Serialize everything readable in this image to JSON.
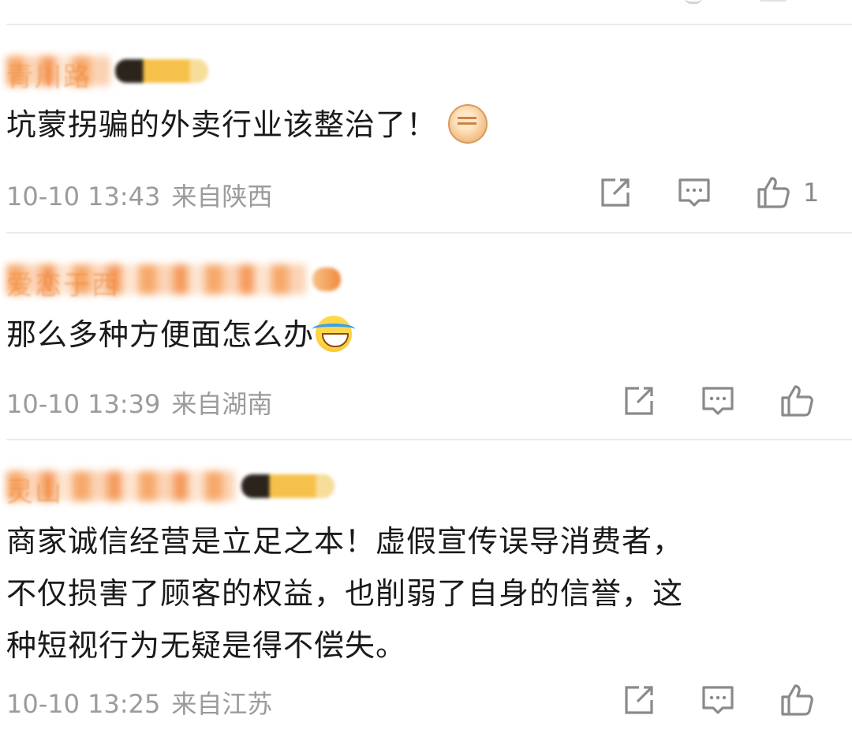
{
  "comments": [
    {
      "username": "青川路",
      "comment_text": "坑蒙拐骗的外卖行业该整治了！",
      "emoji": "fist-emoji",
      "time": "10-10 13:43",
      "location": "来自陕西",
      "like_count": "1"
    },
    {
      "username": "爱恋于西",
      "comment_text": "那么多种方便面怎么办",
      "emoji": "laugh-cry-emoji",
      "time": "10-10 13:39",
      "location": "来自湖南",
      "like_count": ""
    },
    {
      "username": "灵山",
      "comment_text_lines": [
        "商家诚信经营是立足之本！虚假宣传误导消费者，",
        "不仅损害了顾客的权益，也削弱了自身的信誉，这",
        "种短视行为无疑是得不偿失。"
      ],
      "time": "10-10 13:25",
      "location": "来自江苏",
      "like_count": ""
    }
  ],
  "icons": {
    "share": "share-icon",
    "reply": "comment-icon",
    "like": "thumbs-up-icon"
  },
  "colors": {
    "username": "#f08a3c",
    "meta": "#9b9b9b",
    "divider": "#ececec",
    "text": "#1a1a1a"
  }
}
